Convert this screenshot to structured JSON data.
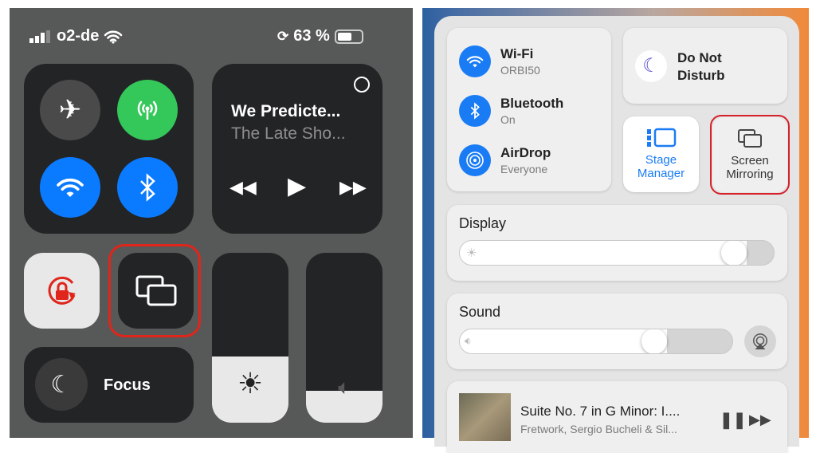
{
  "ios": {
    "status": {
      "carrier": "o2-de",
      "battery_text": "63 %",
      "battery_level": 0.63
    },
    "connectivity": {
      "airplane": "airplane-icon",
      "cellular": "cellular-icon",
      "wifi": "wifi-icon",
      "bluetooth": "bluetooth-icon"
    },
    "media": {
      "title": "We Predicte...",
      "subtitle": "The Late Sho..."
    },
    "focus_label": "Focus",
    "brightness_level": 0.39,
    "volume_level": 0.19,
    "colors": {
      "green": "#34c759",
      "blue": "#0a7aff",
      "red": "#e0251b"
    }
  },
  "mac": {
    "wifi": {
      "label": "Wi-Fi",
      "value": "ORBI50"
    },
    "bluetooth": {
      "label": "Bluetooth",
      "value": "On"
    },
    "airdrop": {
      "label": "AirDrop",
      "value": "Everyone"
    },
    "dnd": {
      "line1": "Do Not",
      "line2": "Disturb"
    },
    "stage": {
      "line1": "Stage",
      "line2": "Manager"
    },
    "mirroring": {
      "line1": "Screen",
      "line2": "Mirroring"
    },
    "display": {
      "label": "Display",
      "level": 0.9
    },
    "sound": {
      "label": "Sound",
      "level": 0.73
    },
    "music": {
      "title": "Suite No. 7 in G Minor: I....",
      "artist": "Fretwork, Sergio Bucheli & Sil..."
    }
  }
}
